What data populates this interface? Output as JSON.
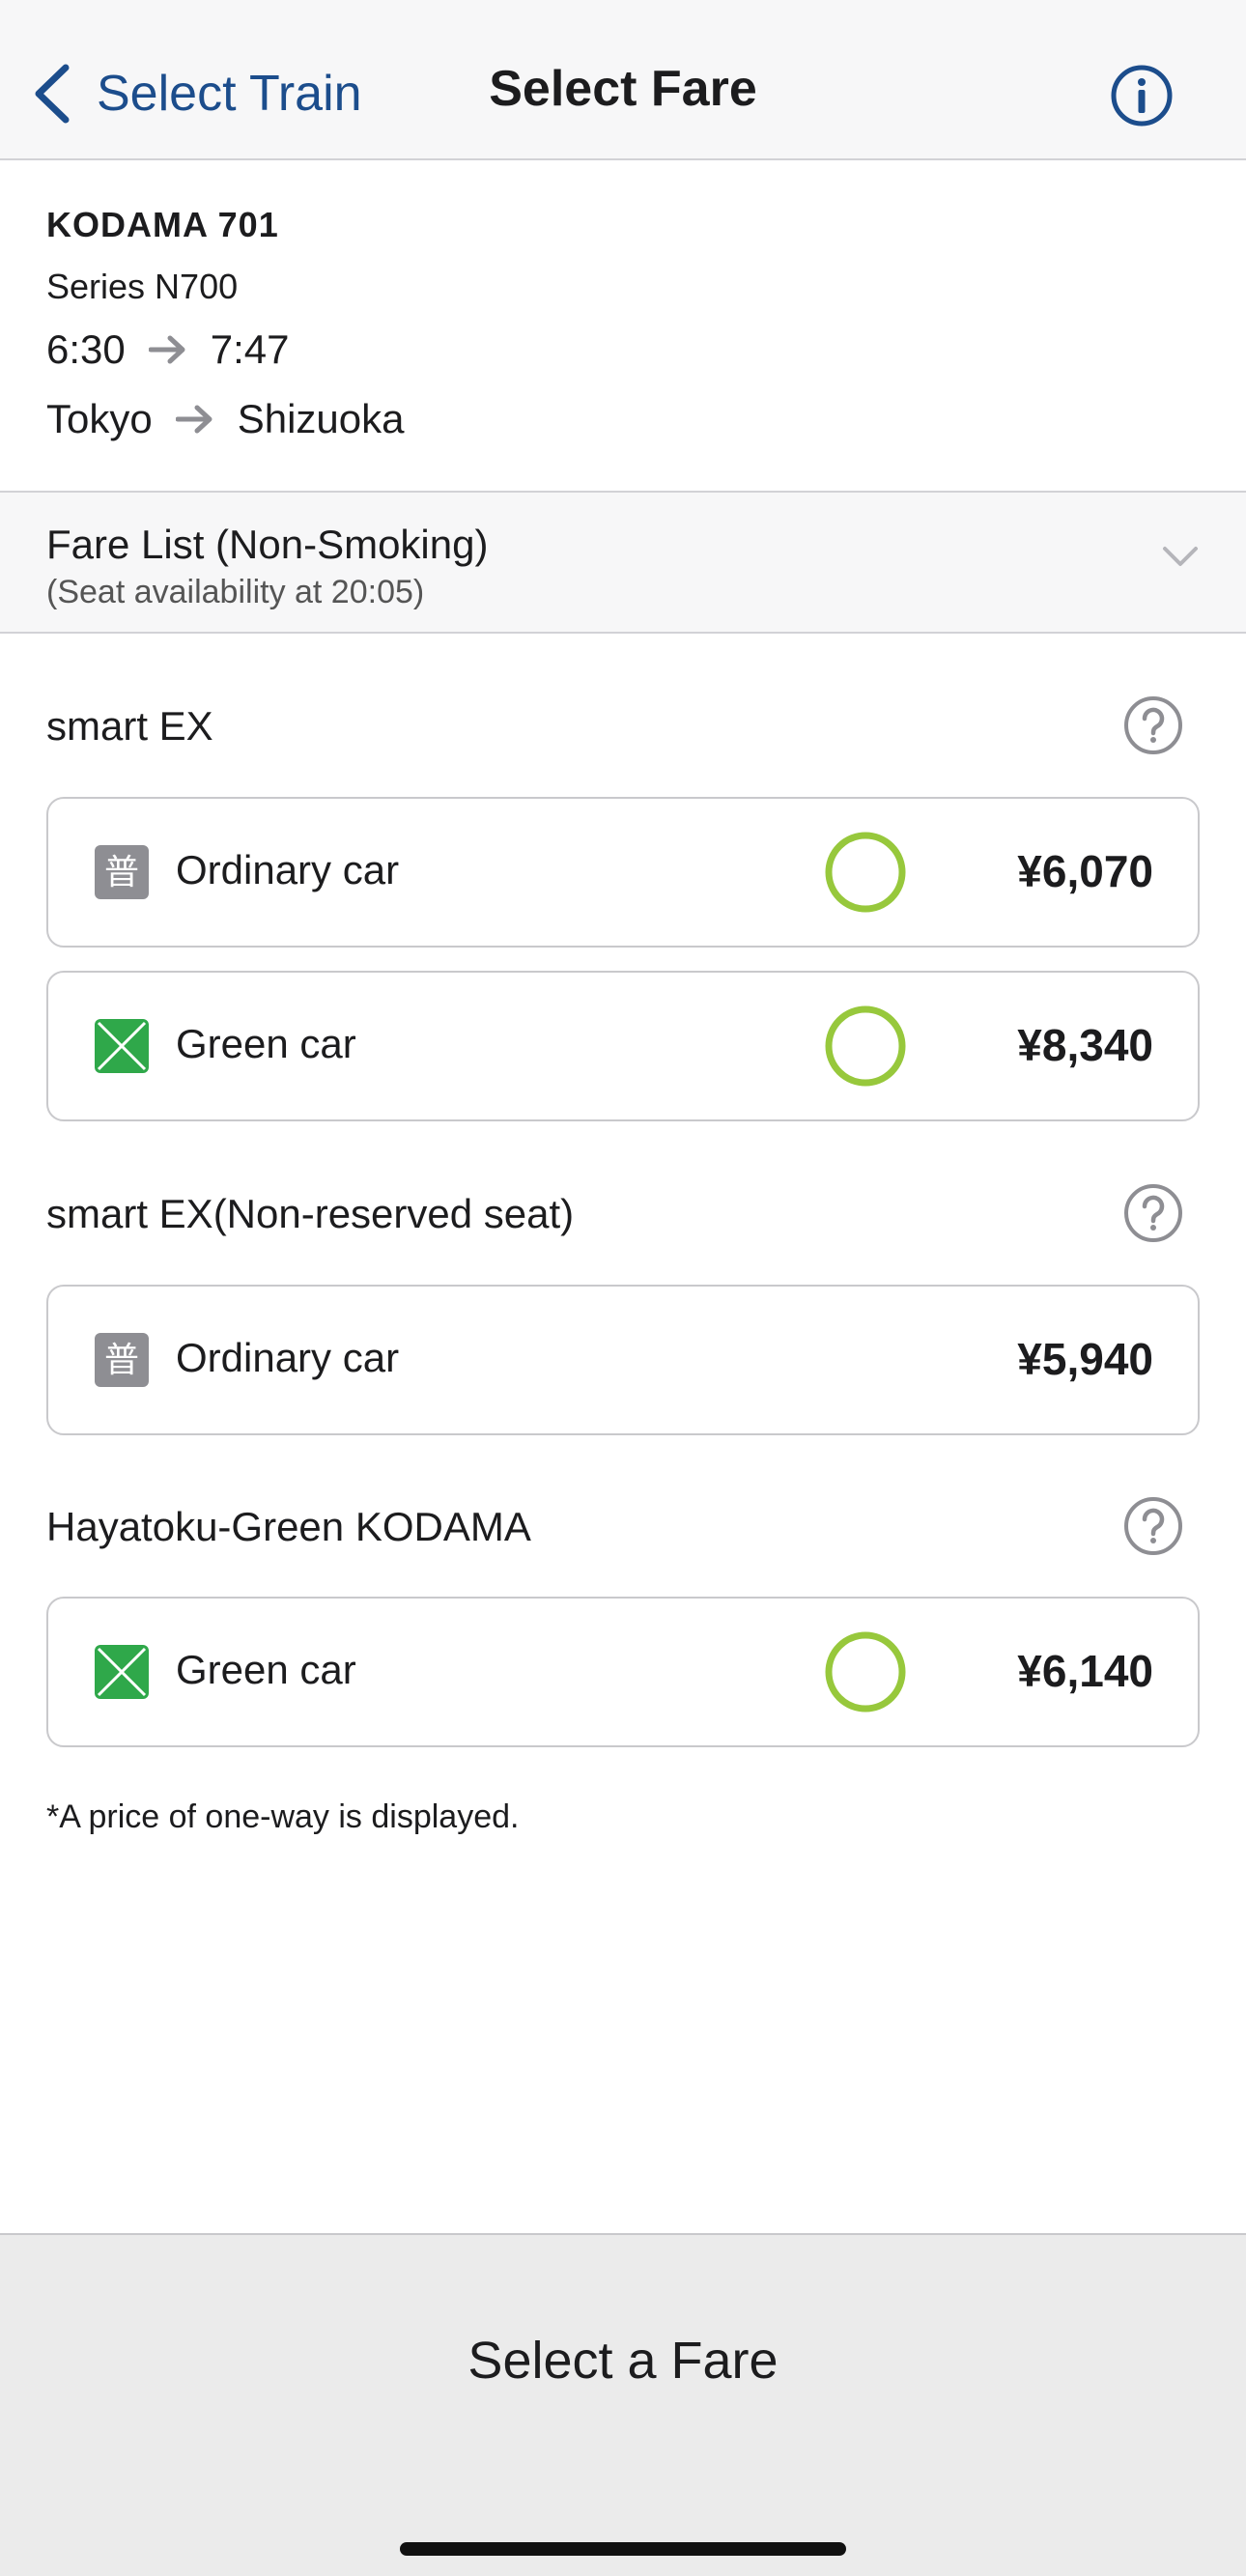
{
  "navbar": {
    "back_label": "Select Train",
    "title": "Select Fare",
    "accent": "#1c4d8c"
  },
  "train": {
    "name": "KODAMA 701",
    "series": "Series N700",
    "depart_time": "6:30",
    "arrive_time": "7:47",
    "from": "Tokyo",
    "to": "Shizuoka"
  },
  "fare_list": {
    "title": "Fare List (Non-Smoking)",
    "subtitle": "(Seat availability at 20:05)"
  },
  "sections": [
    {
      "title": "smart EX",
      "rows": [
        {
          "car": "Ordinary car",
          "icon": "ordinary-car-icon",
          "available": true,
          "price": "¥6,070"
        },
        {
          "car": "Green car",
          "icon": "green-car-icon",
          "available": true,
          "price": "¥8,340"
        }
      ]
    },
    {
      "title": "smart EX(Non-reserved seat)",
      "rows": [
        {
          "car": "Ordinary car",
          "icon": "ordinary-car-icon",
          "available": null,
          "price": "¥5,940"
        }
      ]
    },
    {
      "title": "Hayatoku-Green KODAMA",
      "rows": [
        {
          "car": "Green car",
          "icon": "green-car-icon",
          "available": true,
          "price": "¥6,140"
        }
      ]
    }
  ],
  "note": "*A price of one-way is displayed.",
  "bottom": {
    "button_label": "Select a Fare"
  },
  "icons": {
    "ordinary_glyph": "普"
  },
  "colors": {
    "available": "#97c83c",
    "green_car": "#2fa84a",
    "ordinary_bg": "#8e8e93"
  }
}
